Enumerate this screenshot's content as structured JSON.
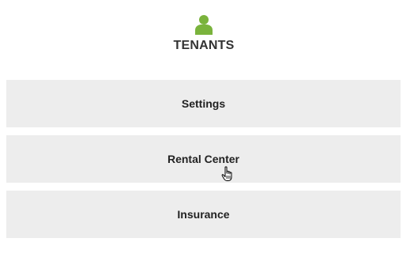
{
  "header": {
    "icon": "user-icon",
    "title": "TENANTS",
    "accent_color": "#7ab33c"
  },
  "menu": {
    "items": [
      {
        "label": "Settings"
      },
      {
        "label": "Rental Center"
      },
      {
        "label": "Insurance"
      }
    ],
    "background_color": "#ededed"
  },
  "cursor": {
    "icon": "hand-pointer-icon",
    "over": "Rental Center"
  }
}
